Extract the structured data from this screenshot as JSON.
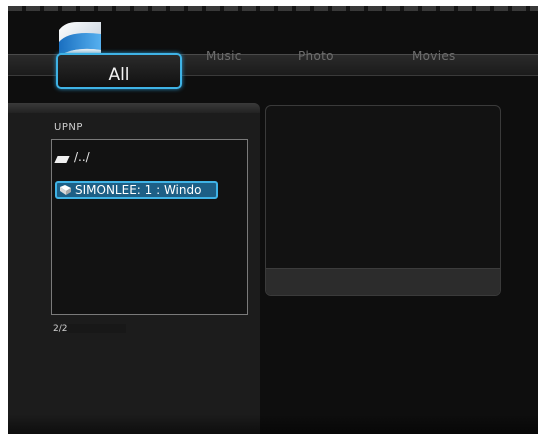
{
  "header": {
    "tabs": [
      {
        "label": "All",
        "active": true
      },
      {
        "label": "Music",
        "active": false
      },
      {
        "label": "Photo",
        "active": false
      },
      {
        "label": "Movies",
        "active": false
      }
    ]
  },
  "browser": {
    "source": "UPNP",
    "items": [
      {
        "label": "/../",
        "icon": "parent-folder-icon",
        "selected": false
      },
      {
        "label": "SIMONLEE: 1 : Windo",
        "icon": "network-share-icon",
        "selected": true
      }
    ],
    "page_count": "2/2"
  },
  "colors": {
    "accent": "#3fb3e6",
    "selection": "#1d5f86",
    "background": "#0e0e0e"
  }
}
